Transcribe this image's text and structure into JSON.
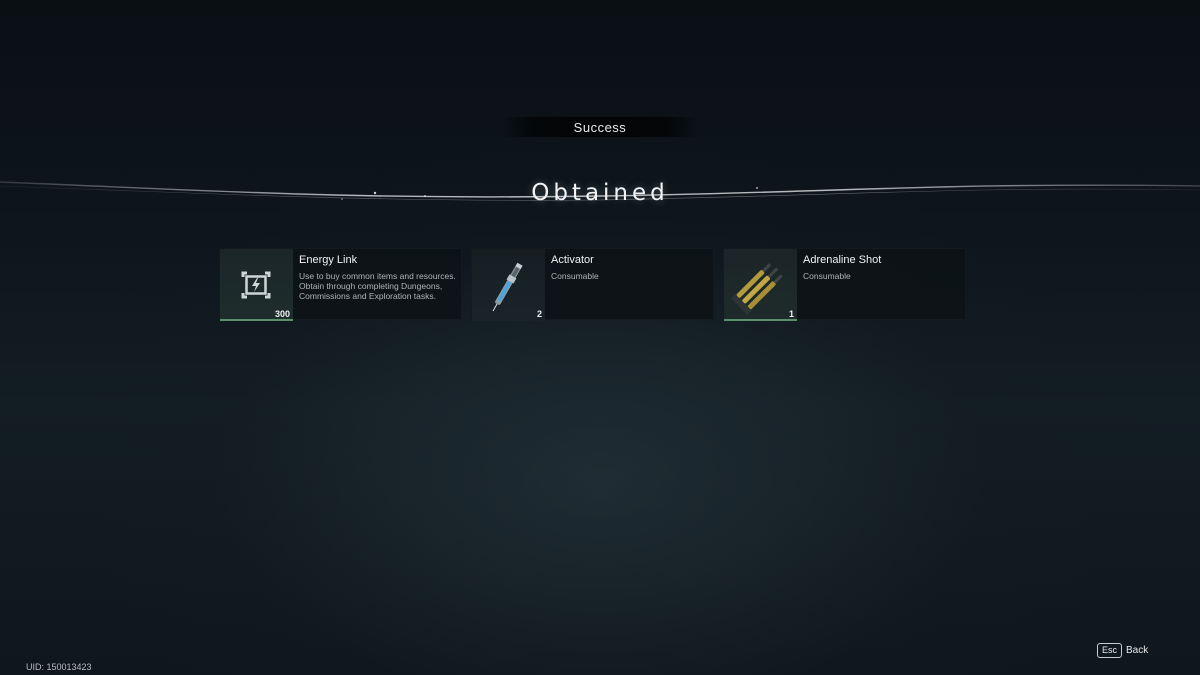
{
  "header": {
    "status": "Success",
    "title": "Obtained"
  },
  "items": [
    {
      "name": "Energy Link",
      "description": "Use to buy common items and resources. Obtain through completing Dungeons, Commissions and Exploration tasks.",
      "quantity": "300",
      "icon": "energy-link-icon"
    },
    {
      "name": "Activator",
      "description": "Consumable",
      "quantity": "2",
      "icon": "activator-syringe-icon"
    },
    {
      "name": "Adrenaline Shot",
      "description": "Consumable",
      "quantity": "1",
      "icon": "adrenaline-shot-icon"
    }
  ],
  "footer": {
    "uid": "UID: 150013423",
    "back_key": "Esc",
    "back_label": "Back"
  },
  "colors": {
    "accent_green": "#5c8f6c",
    "card_bg": "#0c1216"
  }
}
